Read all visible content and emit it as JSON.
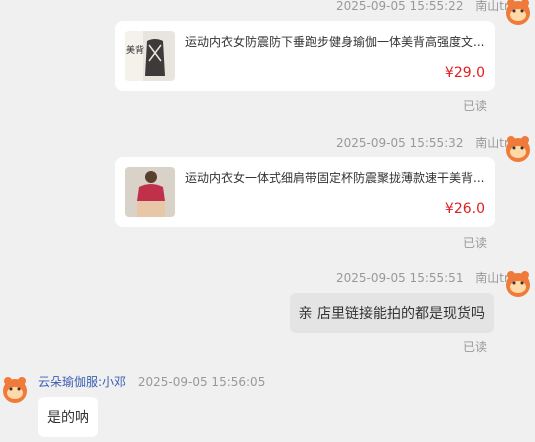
{
  "messages": [
    {
      "timestamp": "2025-09-05 15:55:22",
      "sender": "南山tm",
      "product": {
        "thumb_text": "美背",
        "title": "运动内衣女防震防下垂跑步健身瑜伽一体美背高强度文...",
        "price": "¥29.0"
      },
      "status": "已读"
    },
    {
      "timestamp": "2025-09-05 15:55:32",
      "sender": "南山tm",
      "product": {
        "title": "运动内衣女一体式细肩带固定杯防震聚拢薄款速干美背...",
        "price": "¥26.0"
      },
      "status": "已读"
    },
    {
      "timestamp": "2025-09-05 15:55:51",
      "sender": "南山tm",
      "text": "亲 店里链接能拍的都是现货吗",
      "status": "已读"
    },
    {
      "sender": "云朵瑜伽服:小邓",
      "timestamp": "2025-09-05 15:56:05",
      "text": "是的呐"
    }
  ],
  "colors": {
    "background": "#f0f0f0",
    "price": "#e02020",
    "agent_name": "#3a5db3",
    "avatar": "#f07a3a"
  }
}
